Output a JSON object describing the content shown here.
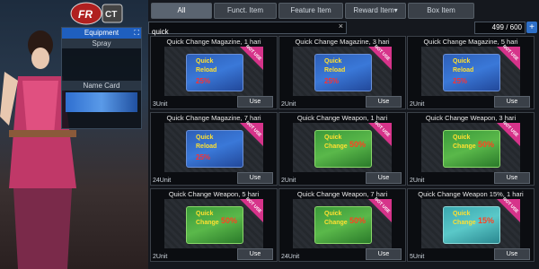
{
  "left_panel": {
    "logo": "FR CT",
    "equipment": "Equipment",
    "spray": "Spray",
    "name_card": "Name Card"
  },
  "tabs": [
    {
      "label": "All",
      "active": true
    },
    {
      "label": "Funct. Item",
      "active": false
    },
    {
      "label": "Feature Item",
      "active": false
    },
    {
      "label": "Reward Item▾",
      "active": false
    },
    {
      "label": "Box Item",
      "active": false
    }
  ],
  "search": {
    "value": "quick",
    "clear": "×"
  },
  "inventory_count": "499 / 600",
  "add_icon": "+",
  "not_use": "NOT USE",
  "use_label": "Use",
  "items": [
    {
      "title": "Quick Change Magazine, 1 hari",
      "unit": "3Unit",
      "kind": "mag",
      "l1": "Quick",
      "l2": "Reload",
      "l3": "25%",
      "pct": ""
    },
    {
      "title": "Quick Change Magazine, 3 hari",
      "unit": "2Unit",
      "kind": "mag",
      "l1": "Quick",
      "l2": "Reload",
      "l3": "25%",
      "pct": ""
    },
    {
      "title": "Quick Change Magazine, 5 hari",
      "unit": "2Unit",
      "kind": "mag",
      "l1": "Quick",
      "l2": "Reload",
      "l3": "25%",
      "pct": ""
    },
    {
      "title": "Quick Change Magazine, 7 hari",
      "unit": "24Unit",
      "kind": "mag",
      "l1": "Quick",
      "l2": "Reload",
      "l3": "25%",
      "pct": ""
    },
    {
      "title": "Quick Change Weapon, 1 hari",
      "unit": "2Unit",
      "kind": "weap",
      "l1": "Quick",
      "l2": "Change",
      "l3": "",
      "pct": "50%"
    },
    {
      "title": "Quick Change Weapon, 3 hari",
      "unit": "2Unit",
      "kind": "weap",
      "l1": "Quick",
      "l2": "Change",
      "l3": "",
      "pct": "50%"
    },
    {
      "title": "Quick Change Weapon, 5 hari",
      "unit": "2Unit",
      "kind": "weap",
      "l1": "Quick",
      "l2": "Change",
      "l3": "",
      "pct": "50%"
    },
    {
      "title": "Quick Change Weapon, 7 hari",
      "unit": "24Unit",
      "kind": "weap",
      "l1": "Quick",
      "l2": "Change",
      "l3": "",
      "pct": "50%"
    },
    {
      "title": "Quick Change Weapon 15%, 1 hari",
      "unit": "5Unit",
      "kind": "cyan",
      "l1": "Quick",
      "l2": "Change",
      "l3": "",
      "pct": "15%"
    }
  ]
}
